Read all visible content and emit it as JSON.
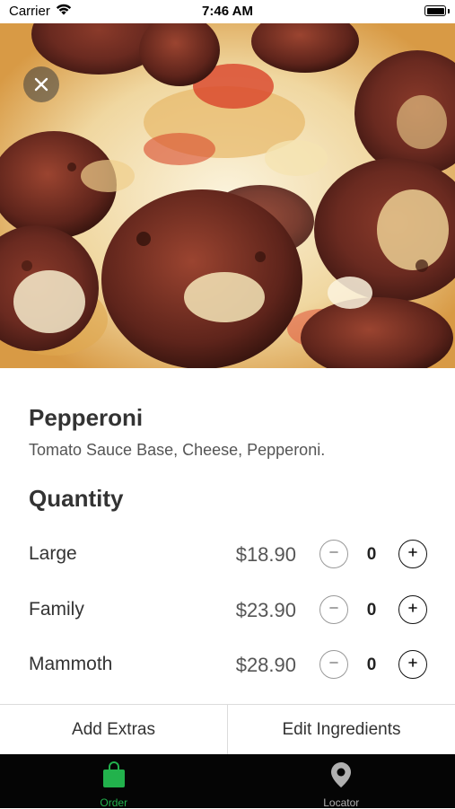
{
  "status_bar": {
    "carrier": "Carrier",
    "time": "7:46 AM"
  },
  "hero": {
    "image": "pepperoni-pizza-photo",
    "close_icon": "close-icon"
  },
  "product": {
    "name": "Pepperoni",
    "description": "Tomato Sauce Base, Cheese, Pepperoni."
  },
  "quantity": {
    "title": "Quantity",
    "sizes": [
      {
        "label": "Large",
        "price": "$18.90",
        "qty": "0"
      },
      {
        "label": "Family",
        "price": "$23.90",
        "qty": "0"
      },
      {
        "label": "Mammoth",
        "price": "$28.90",
        "qty": "0"
      }
    ]
  },
  "actions": {
    "add_extras": "Add Extras",
    "edit_ingredients": "Edit Ingredients"
  },
  "tabs": [
    {
      "label": "Order",
      "icon": "shopping-bag-icon",
      "active": true
    },
    {
      "label": "Locator",
      "icon": "location-pin-icon",
      "active": false
    }
  ],
  "colors": {
    "accent": "#22b24c",
    "tab_bar_bg": "#050505",
    "inactive_tab": "#b0b0b0"
  }
}
